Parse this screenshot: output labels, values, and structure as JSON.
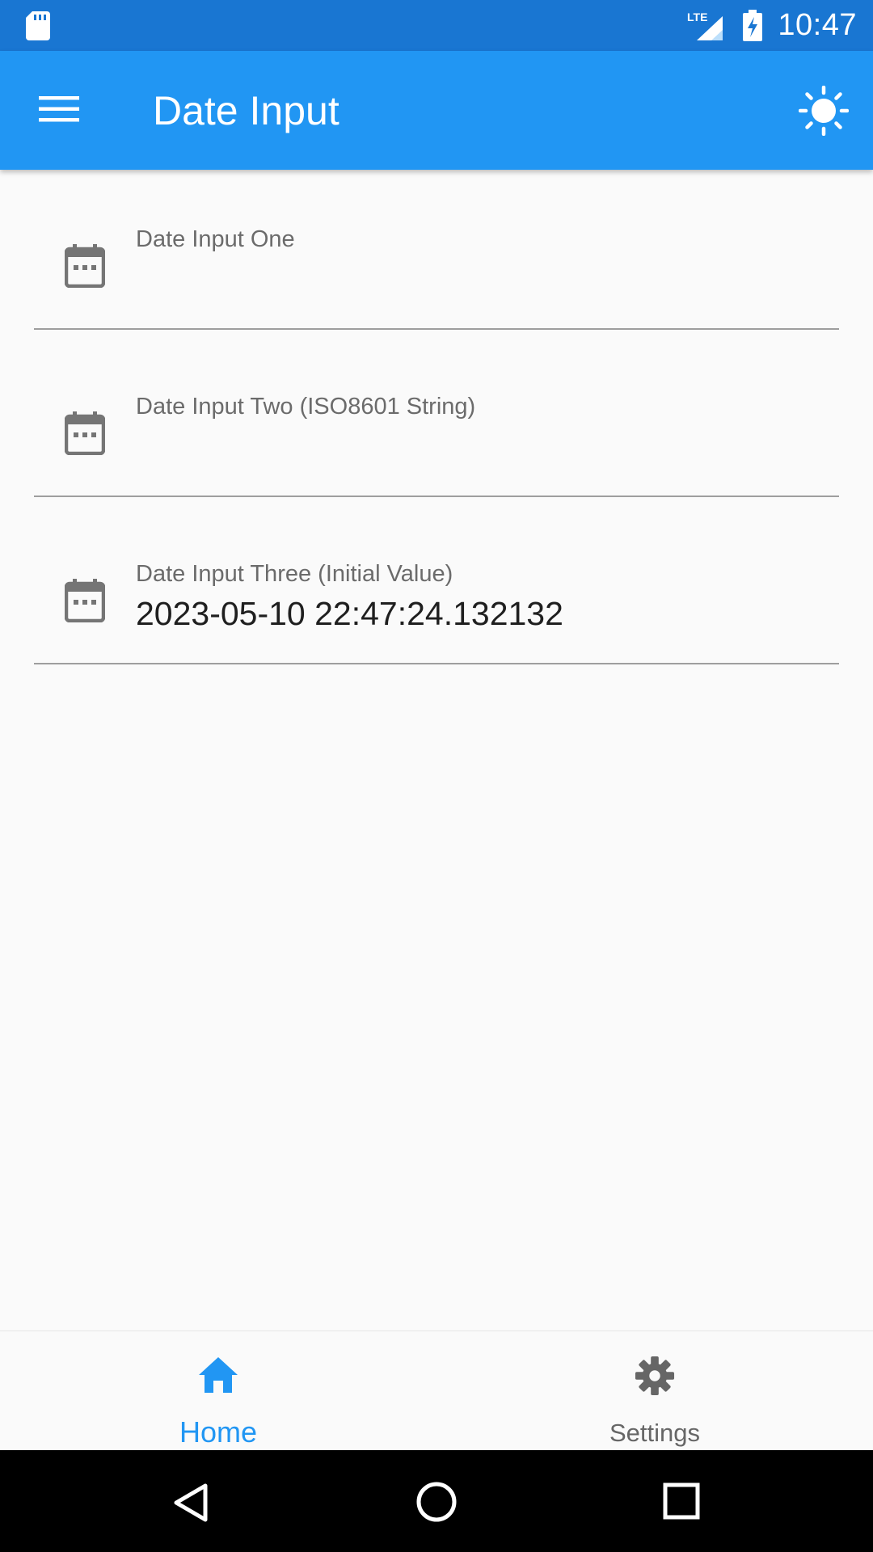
{
  "status_bar": {
    "network": "LTE",
    "time": "10:47"
  },
  "app_bar": {
    "title": "Date Input",
    "menu_icon": "menu-icon",
    "theme_icon": "sun-icon"
  },
  "fields": [
    {
      "label": "Date Input One",
      "value": "",
      "icon": "calendar-icon"
    },
    {
      "label": "Date Input Two (ISO8601 String)",
      "value": "",
      "icon": "calendar-icon"
    },
    {
      "label": "Date Input Three (Initial Value)",
      "value": "2023-05-10 22:47:24.132132",
      "icon": "calendar-icon"
    }
  ],
  "bottom_nav": {
    "items": [
      {
        "label": "Home",
        "icon": "home-icon",
        "selected": true
      },
      {
        "label": "Settings",
        "icon": "gear-icon",
        "selected": false
      }
    ]
  },
  "colors": {
    "primary": "#2196f3",
    "status_bar": "#1976d2",
    "background": "#fafafa",
    "icon_gray": "#757575"
  }
}
